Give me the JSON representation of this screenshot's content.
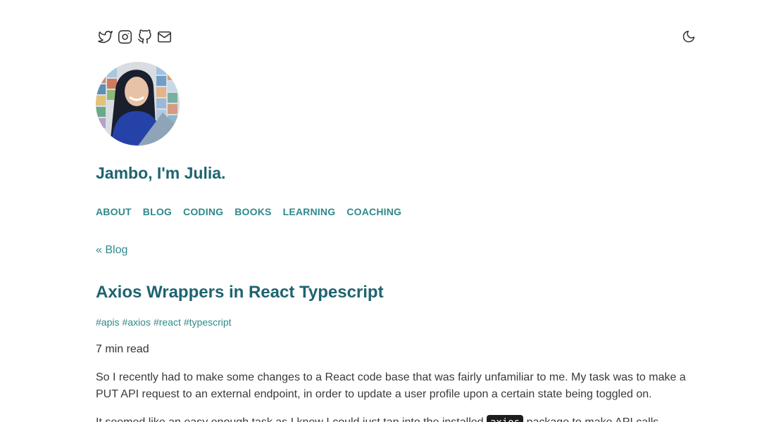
{
  "social": {
    "icons": [
      "twitter-icon",
      "instagram-icon",
      "github-icon",
      "mail-icon"
    ]
  },
  "theme_toggle": {
    "icon": "moon-icon"
  },
  "site": {
    "title": "Jambo, I'm Julia."
  },
  "nav": {
    "items": [
      {
        "label": "ABOUT"
      },
      {
        "label": "BLOG"
      },
      {
        "label": "CODING"
      },
      {
        "label": "BOOKS"
      },
      {
        "label": "LEARNING"
      },
      {
        "label": "COACHING"
      }
    ]
  },
  "back_link": "« Blog",
  "post": {
    "title": "Axios Wrappers in React Typescript",
    "tags": [
      "#apis",
      "#axios",
      "#react",
      "#typescript"
    ],
    "read_time": "7 min read",
    "paragraphs": [
      "So I recently had to make some changes to a React code base that was fairly unfamiliar to me. My task was to make a PUT API request to an external endpoint, in order to update a user profile upon a certain state being toggled on."
    ],
    "para2_before": "It seemed like an easy enough task as I knew I could just tap into the installed",
    "para2_code": "axios",
    "para2_after": "package to make API calls."
  },
  "colors": {
    "heading": "#1e6470",
    "link": "#2d8a8a",
    "text": "#333333",
    "code_bg": "#1e1e1e"
  }
}
